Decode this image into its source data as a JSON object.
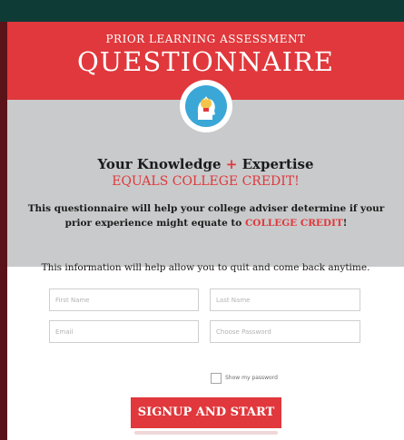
{
  "header": {
    "subtitle": "PRIOR LEARNING ASSESSMENT",
    "title": "QUESTIONNAIRE"
  },
  "intro": {
    "headline_part1": "Your Knowledge",
    "headline_plus": "+",
    "headline_part2": "Expertise",
    "headline_emphasis": "EQUALS COLLEGE CREDIT!",
    "description_part1": "This questionnaire will help your college adviser determine if your prior experience might equate to",
    "description_emphasis": "COLLEGE CREDIT",
    "description_end": "!"
  },
  "form": {
    "info_text": "This information will help allow you to quit and come back anytime.",
    "first_name_placeholder": "First Name",
    "last_name_placeholder": "Last Name",
    "email_placeholder": "Email",
    "password_placeholder": "Choose Password",
    "show_password_label": "Show my password",
    "submit_label": "SIGNUP AND START"
  },
  "colors": {
    "accent": "#e0383c",
    "dark_bar": "#0f3b37",
    "background": "#6f1d22",
    "grey_band": "#c9cacb",
    "icon_circle": "#3aa7d7"
  },
  "icons": {
    "badge": "lightbulb-head-icon"
  }
}
